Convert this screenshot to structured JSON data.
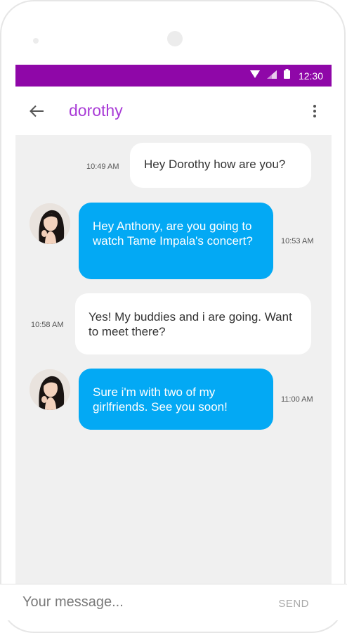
{
  "status_bar": {
    "time": "12:30",
    "background_color": "#8f07a8",
    "icons": [
      "wifi-icon",
      "signal-icon",
      "battery-icon"
    ]
  },
  "app_bar": {
    "contact_name": "dorothy",
    "name_color": "#a83ad6",
    "back_icon": "arrow-left-icon",
    "menu_icon": "more-vert-icon"
  },
  "messages": [
    {
      "direction": "outgoing",
      "text": "Hey Dorothy how are you?",
      "time": "10:49 AM"
    },
    {
      "direction": "incoming",
      "text": "Hey Anthony, are you going to watch Tame Impala's concert?",
      "time": "10:53 AM",
      "avatar": "contact-avatar"
    },
    {
      "direction": "outgoing",
      "text": "Yes! My buddies and i are going. Want to meet there?",
      "time": "10:58 AM"
    },
    {
      "direction": "incoming",
      "text": "Sure i'm with two of my girlfriends. See you soon!",
      "time": "11:00 AM",
      "avatar": "contact-avatar"
    }
  ],
  "colors": {
    "incoming_bubble": "#03a9f4",
    "outgoing_bubble": "#ffffff",
    "chat_background": "#f0f0f0"
  },
  "composer": {
    "placeholder": "Your message...",
    "send_label": "SEND"
  }
}
